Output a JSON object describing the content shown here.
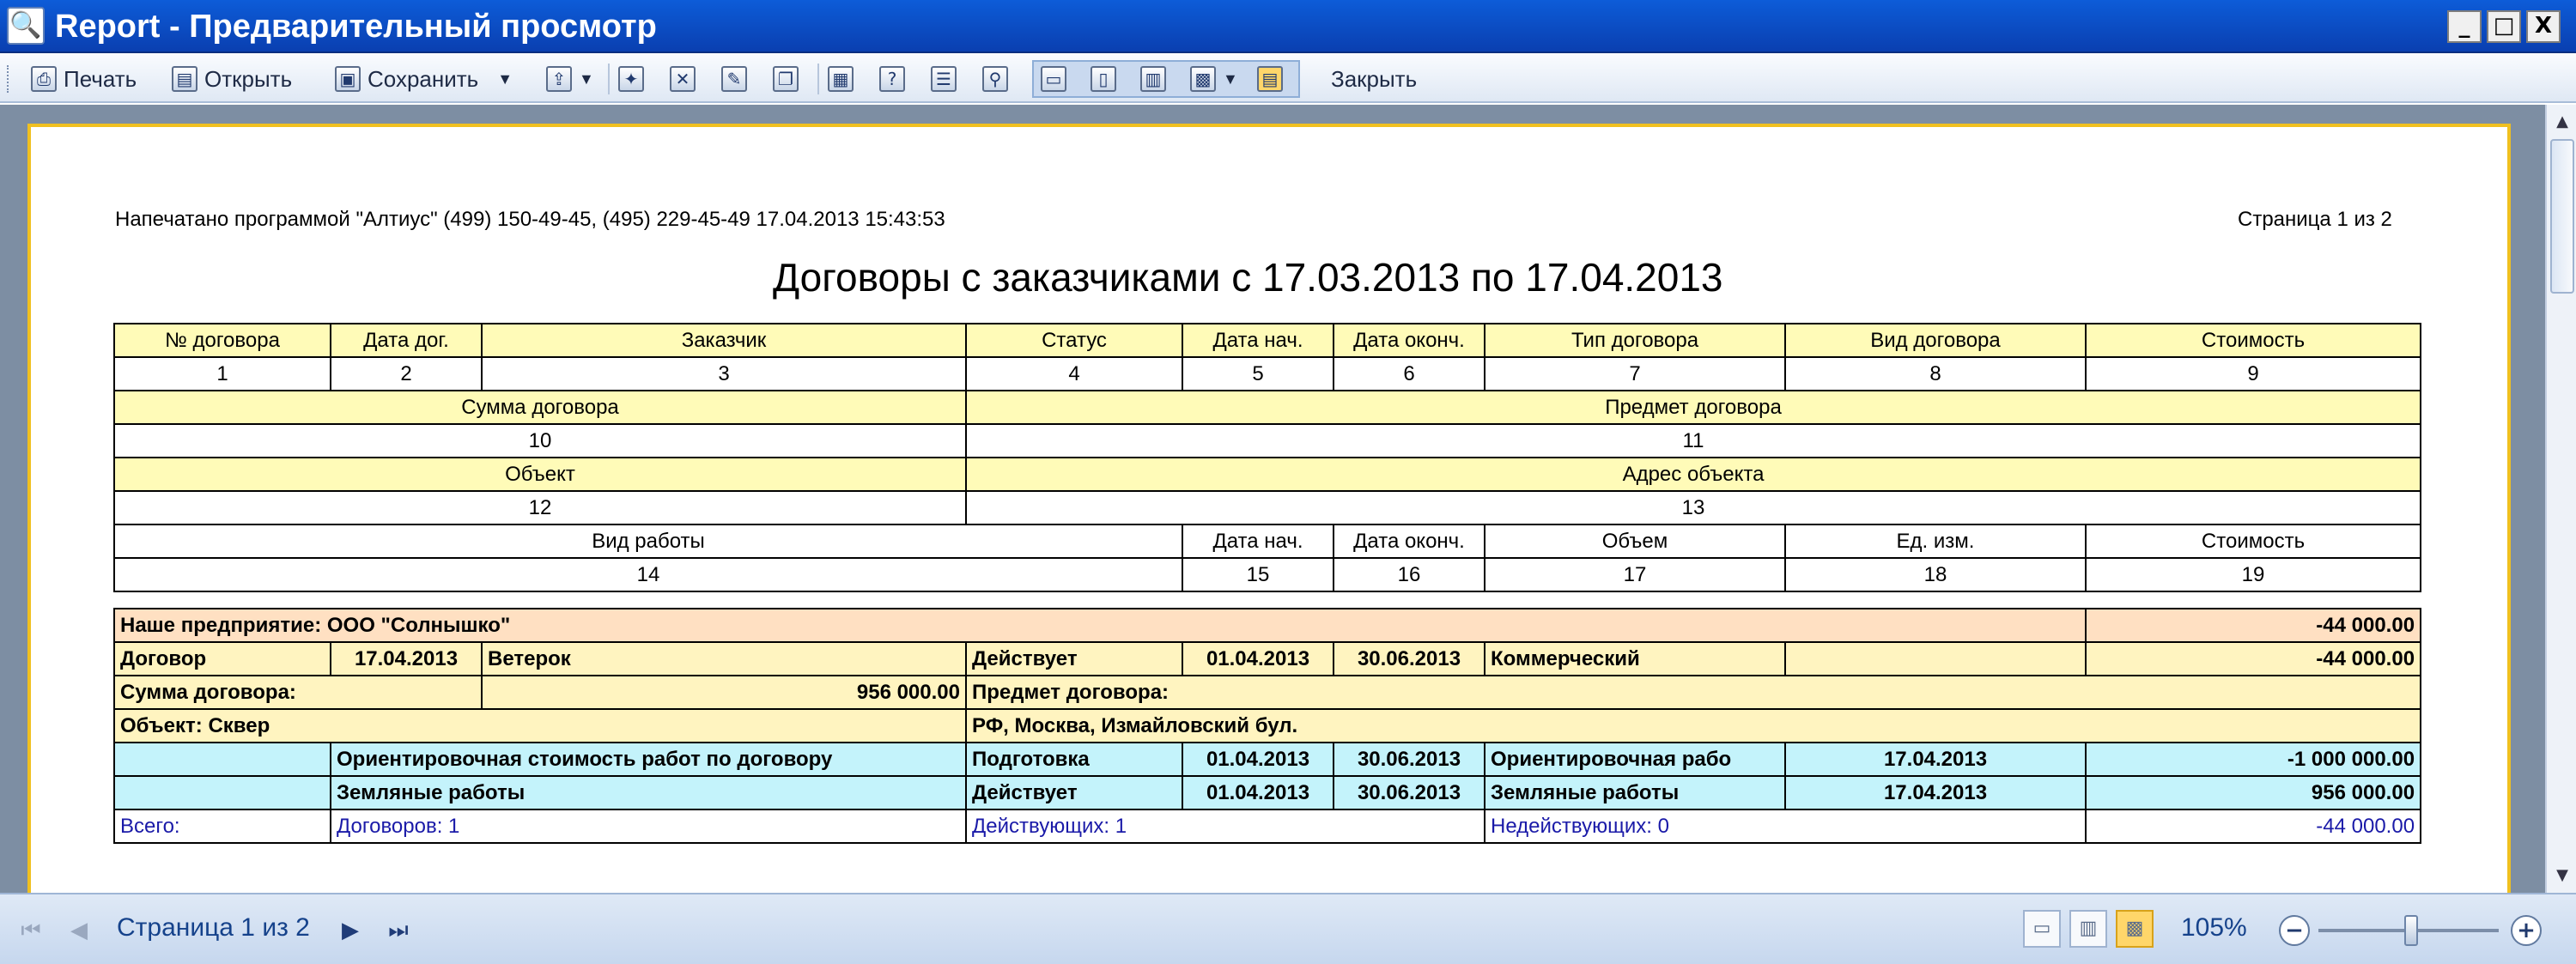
{
  "window": {
    "title": "Report - Предварительный просмотр",
    "minimize": "_",
    "maximize": "□",
    "close": "X"
  },
  "toolbar": {
    "print": "Печать",
    "open": "Открыть",
    "save": "Сохранить",
    "close": "Закрыть"
  },
  "report": {
    "printed_by": "Напечатано программой \"Алтиус\" (499) 150-49-45, (495) 229-45-49 17.04.2013 15:43:53",
    "page_info": "Страница 1 из 2",
    "title": "Договоры с заказчиками с 17.03.2013 по 17.04.2013",
    "legend": {
      "row1": [
        "№ договора",
        "Дата дог.",
        "Заказчик",
        "Статус",
        "Дата нач.",
        "Дата оконч.",
        "Тип договора",
        "Вид договора",
        "Стоимость"
      ],
      "row1n": [
        "1",
        "2",
        "3",
        "4",
        "5",
        "6",
        "7",
        "8",
        "9"
      ],
      "row2": [
        "Сумма договора",
        "Предмет договора"
      ],
      "row2n": [
        "10",
        "11"
      ],
      "row3": [
        "Объект",
        "Адрес объекта"
      ],
      "row3n": [
        "12",
        "13"
      ],
      "row4": [
        "Вид работы",
        "Дата нач.",
        "Дата оконч.",
        "Объем",
        "Ед. изм.",
        "Стоимость"
      ],
      "row4n": [
        "14",
        "15",
        "16",
        "17",
        "18",
        "19"
      ]
    },
    "org": {
      "label": "Наше предприятие: ООО \"Солнышко\"",
      "amount": "-44 000.00"
    },
    "contract": {
      "type": "Договор",
      "date": "17.04.2013",
      "customer": "Ветерок",
      "status": "Действует",
      "start": "01.04.2013",
      "end": "30.06.2013",
      "ctype": "Коммерческий",
      "kind": "",
      "cost": "-44 000.00"
    },
    "sum": {
      "label": "Сумма договора:",
      "value": "956 000.00",
      "subject_label": "Предмет договора:"
    },
    "object": {
      "label": "Объект: Сквер",
      "address": "РФ, Москва, Измайловский бул."
    },
    "works": [
      {
        "name": "Ориентировочная стоимость работ по договору",
        "status": "Подготовка",
        "start": "01.04.2013",
        "end": "30.06.2013",
        "type": "Ориентировочная рабо",
        "date": "17.04.2013",
        "cost": "-1 000 000.00"
      },
      {
        "name": "Земляные работы",
        "status": "Действует",
        "start": "01.04.2013",
        "end": "30.06.2013",
        "type": "Земляные работы",
        "date": "17.04.2013",
        "cost": "956 000.00"
      }
    ],
    "totals": {
      "all": "Всего:",
      "contracts": "Договоров: 1",
      "active": "Действующих: 1",
      "inactive": "Недействующих: 0",
      "amount": "-44 000.00"
    }
  },
  "status": {
    "page": "Страница 1 из 2",
    "zoom": "105%"
  }
}
